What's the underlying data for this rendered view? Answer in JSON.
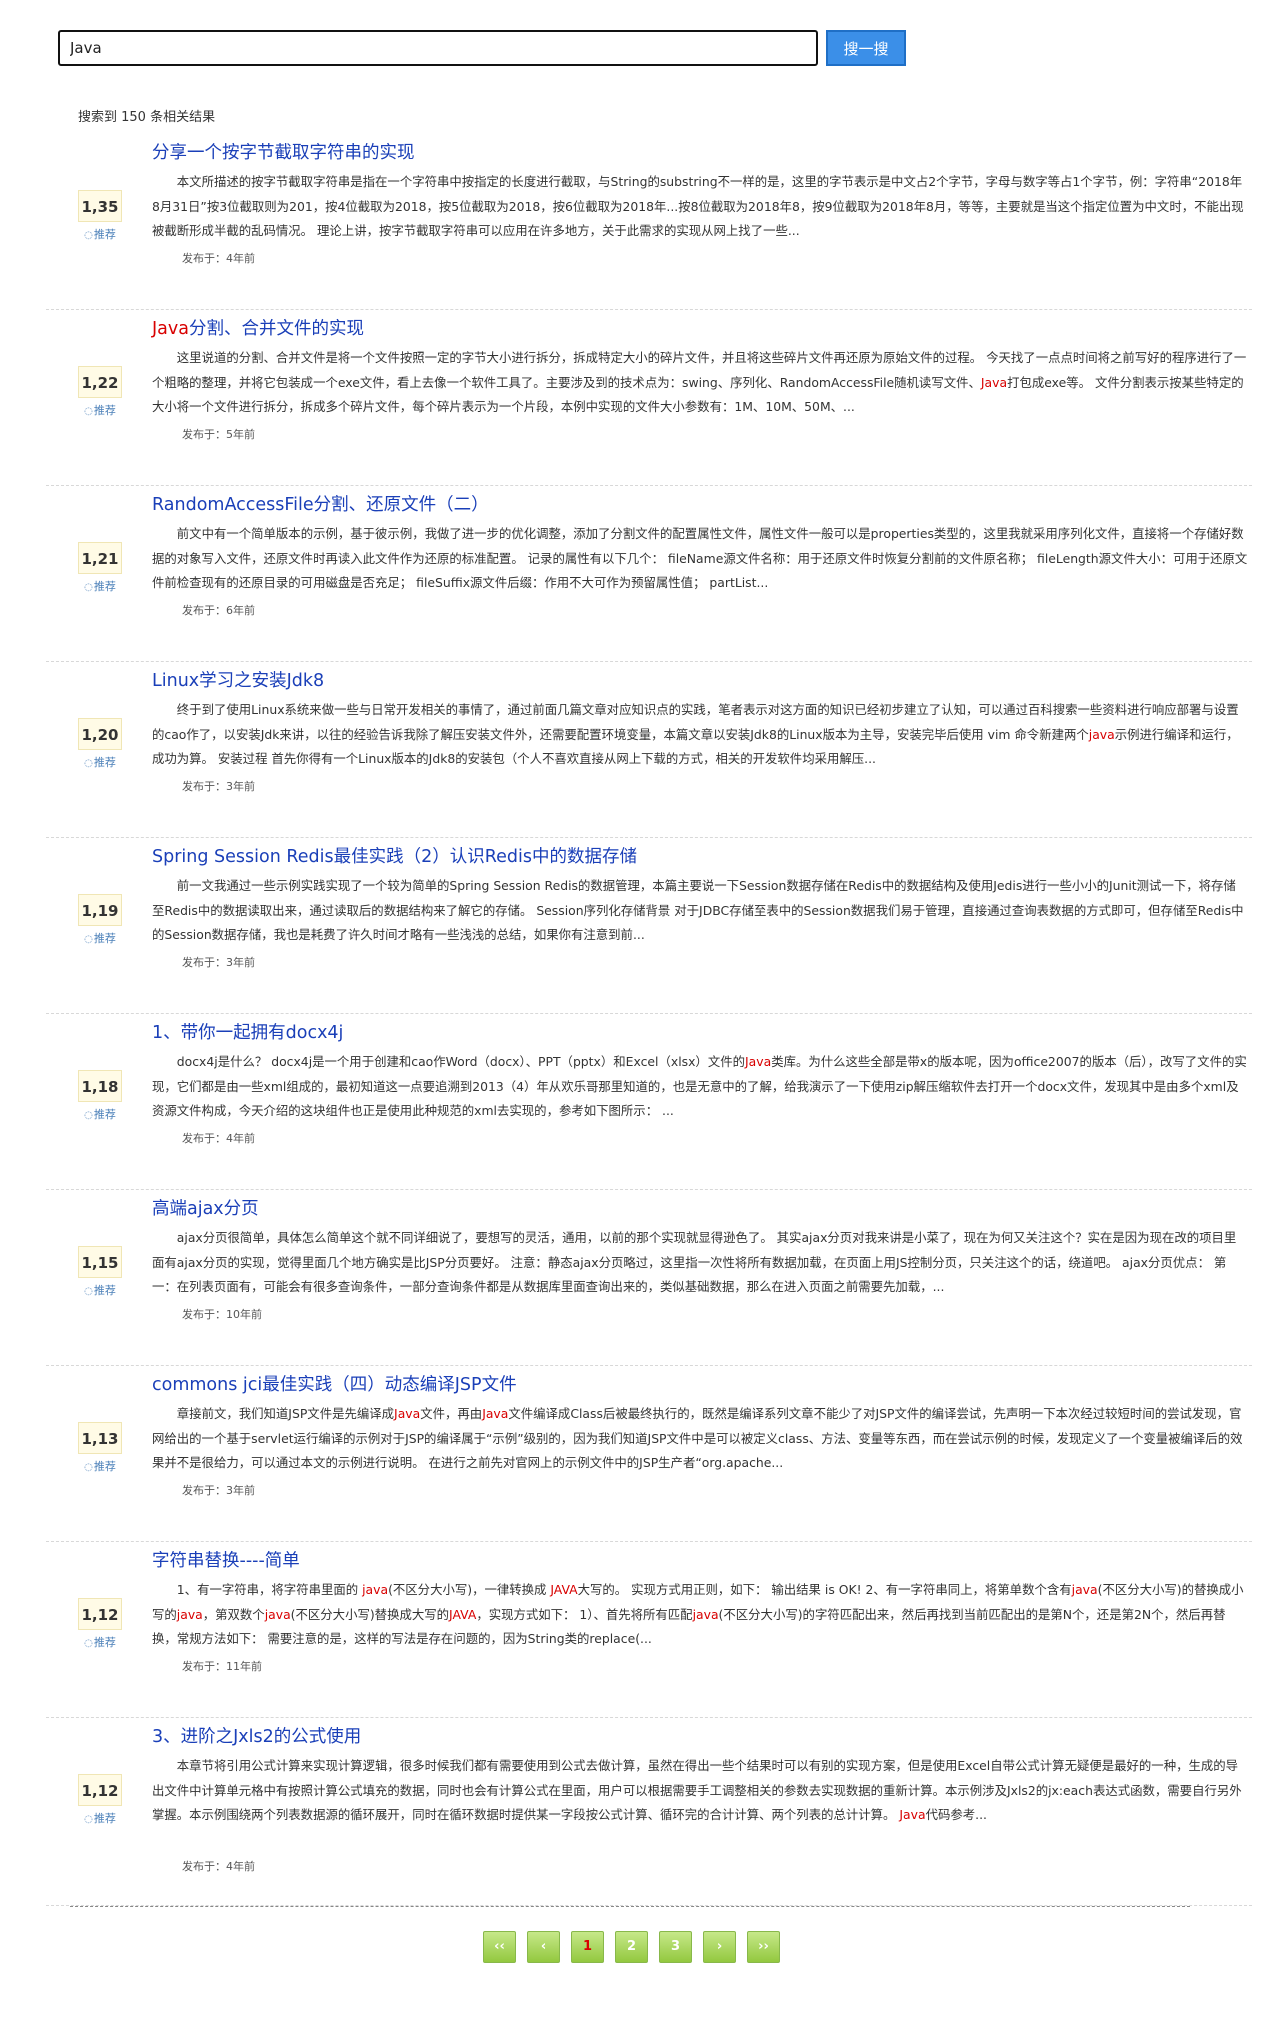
{
  "search": {
    "query": "Java",
    "button_label": "搜一搜"
  },
  "result_count_text": "搜索到 150 条相关结果",
  "recommend_label": "推荐",
  "meta_prefix": "发布于：",
  "results": [
    {
      "title": [
        {
          "t": "分享一个按字节截取字符串的实现"
        }
      ],
      "snippet": [
        {
          "t": "本文所描述的按字节截取字符串是指在一个字符串中按指定的长度进行截取，与String的substring不一样的是，这里的字节表示是中文占2个字节，字母与数字等占1个字节，例：字符串“2018年8月31日”按3位截取则为201，按4位截取为2018，按5位截取为2018，按6位截取为2018年...按8位截取为2018年8，按9位截取为2018年8月，等等，主要就是当这个指定位置为中文时，不能出现被截断形成半截的乱码情况。 理论上讲，按字节截取字符串可以应用在许多地方，关于此需求的实现从网上找了一些..."
        }
      ],
      "votes": "1,35",
      "time": "4年前"
    },
    {
      "title": [
        {
          "t": "Java",
          "hl": true
        },
        {
          "t": "分割、合并文件的实现"
        }
      ],
      "snippet": [
        {
          "t": "这里说道的分割、合并文件是将一个文件按照一定的字节大小进行拆分，拆成特定大小的碎片文件，并且将这些碎片文件再还原为原始文件的过程。 今天找了一点点时间将之前写好的程序进行了一个粗略的整理，并将它包装成一个exe文件，看上去像一个软件工具了。主要涉及到的技术点为：swing、序列化、RandomAccessFile随机读写文件、"
        },
        {
          "t": "Java",
          "hl": true
        },
        {
          "t": "打包成exe等。 文件分割表示按某些特定的大小将一个文件进行拆分，拆成多个碎片文件，每个碎片表示为一个片段，本例中实现的文件大小参数有：1M、10M、50M、..."
        }
      ],
      "votes": "1,22",
      "time": "5年前"
    },
    {
      "title": [
        {
          "t": "RandomAccessFile分割、还原文件（二）"
        }
      ],
      "snippet": [
        {
          "t": "前文中有一个简单版本的示例，基于彼示例，我做了进一步的优化调整，添加了分割文件的配置属性文件，属性文件一般可以是properties类型的，这里我就采用序列化文件，直接将一个存储好数据的对象写入文件，还原文件时再读入此文件作为还原的标准配置。 记录的属性有以下几个： fileName源文件名称：用于还原文件时恢复分割前的文件原名称； fileLength源文件大小：可用于还原文件前检查现有的还原目录的可用磁盘是否充足； fileSuffix源文件后缀：作用不大可作为预留属性值； partList..."
        }
      ],
      "votes": "1,21",
      "time": "6年前"
    },
    {
      "title": [
        {
          "t": "Linux学习之安装Jdk8"
        }
      ],
      "snippet": [
        {
          "t": "终于到了使用Linux系统来做一些与日常开发相关的事情了，通过前面几篇文章对应知识点的实践，笔者表示对这方面的知识已经初步建立了认知，可以通过百科搜索一些资料进行响应部署与设置的cao作了，以安装Jdk来讲，以往的经验告诉我除了解压安装文件外，还需要配置环境变量，本篇文章以安装Jdk8的Linux版本为主导，安装完毕后使用 vim 命令新建两个"
        },
        {
          "t": "java",
          "hl": true
        },
        {
          "t": "示例进行编译和运行，成功为算。 安装过程 首先你得有一个Linux版本的Jdk8的安装包（个人不喜欢直接从网上下载的方式，相关的开发软件均采用解压..."
        }
      ],
      "votes": "1,20",
      "time": "3年前"
    },
    {
      "title": [
        {
          "t": "Spring Session Redis最佳实践（2）认识Redis中的数据存储"
        }
      ],
      "snippet": [
        {
          "t": "前一文我通过一些示例实践实现了一个较为简单的Spring Session Redis的数据管理，本篇主要说一下Session数据存储在Redis中的数据结构及使用Jedis进行一些小小的Junit测试一下，将存储至Redis中的数据读取出来，通过读取后的数据结构来了解它的存储。 Session序列化存储背景 对于JDBC存储至表中的Session数据我们易于管理，直接通过查询表数据的方式即可，但存储至Redis中的Session数据存储，我也是耗费了许久时间才略有一些浅浅的总结，如果你有注意到前..."
        }
      ],
      "votes": "1,19",
      "time": "3年前"
    },
    {
      "title": [
        {
          "t": "1、带你一起拥有docx4j"
        }
      ],
      "snippet": [
        {
          "t": "docx4j是什么？ docx4j是一个用于创建和cao作Word（docx）、PPT（pptx）和Excel（xlsx）文件的"
        },
        {
          "t": "Java",
          "hl": true
        },
        {
          "t": "类库。为什么这些全部是带x的版本呢，因为office2007的版本（后），改写了文件的实现，它们都是由一些xml组成的，最初知道这一点要追溯到2013（4）年从欢乐哥那里知道的，也是无意中的了解，给我演示了一下使用zip解压缩软件去打开一个docx文件，发现其中是由多个xml及资源文件构成，今天介绍的这块组件也正是使用此种规范的xml去实现的，参考如下图所示： ..."
        }
      ],
      "votes": "1,18",
      "time": "4年前"
    },
    {
      "title": [
        {
          "t": "高端ajax分页"
        }
      ],
      "snippet": [
        {
          "t": "ajax分页很简单，具体怎么简单这个就不同详细说了，要想写的灵活，通用，以前的那个实现就显得逊色了。 其实ajax分页对我来讲是小菜了，现在为何又关注这个？实在是因为现在改的项目里面有ajax分页的实现，觉得里面几个地方确实是比JSP分页要好。 注意：静态ajax分页略过，这里指一次性将所有数据加载，在页面上用JS控制分页，只关注这个的话，绕道吧。 ajax分页优点： 第一：在列表页面有，可能会有很多查询条件，一部分查询条件都是从数据库里面查询出来的，类似基础数据，那么在进入页面之前需要先加载，..."
        }
      ],
      "votes": "1,15",
      "time": "10年前"
    },
    {
      "title": [
        {
          "t": "commons jci最佳实践（四）动态编译JSP文件"
        }
      ],
      "snippet": [
        {
          "t": "章接前文，我们知道JSP文件是先编译成"
        },
        {
          "t": "Java",
          "hl": true
        },
        {
          "t": "文件，再由"
        },
        {
          "t": "Java",
          "hl": true
        },
        {
          "t": "文件编译成Class后被最终执行的，既然是编译系列文章不能少了对JSP文件的编译尝试，先声明一下本次经过较短时间的尝试发现，官网给出的一个基于servlet运行编译的示例对于JSP的编译属于“示例”级别的，因为我们知道JSP文件中是可以被定义class、方法、变量等东西，而在尝试示例的时候，发现定义了一个变量被编译后的效果并不是很给力，可以通过本文的示例进行说明。 在进行之前先对官网上的示例文件中的JSP生产者“org.apache..."
        }
      ],
      "votes": "1,13",
      "time": "3年前"
    },
    {
      "title": [
        {
          "t": "字符串替换----简单"
        }
      ],
      "snippet": [
        {
          "t": "1、有一字符串，将字符串里面的 "
        },
        {
          "t": "java",
          "hl": true
        },
        {
          "t": "(不区分大小写)，一律转换成 "
        },
        {
          "t": "JAVA",
          "hl": true
        },
        {
          "t": "大写的。 实现方式用正则，如下： 输出结果 is OK! 2、有一字符串同上，将第单数个含有"
        },
        {
          "t": "java",
          "hl": true
        },
        {
          "t": "(不区分大小写)的替换成小写的"
        },
        {
          "t": "java",
          "hl": true
        },
        {
          "t": "，第双数个"
        },
        {
          "t": "java",
          "hl": true
        },
        {
          "t": "(不区分大小写)替换成大写的"
        },
        {
          "t": "JAVA",
          "hl": true
        },
        {
          "t": "，实现方式如下： 1）、首先将所有匹配"
        },
        {
          "t": "java",
          "hl": true
        },
        {
          "t": "(不区分大小写)的字符匹配出来，然后再找到当前匹配出的是第N个，还是第2N个，然后再替换，常规方法如下： 需要注意的是，这样的写法是存在问题的，因为String类的replace(..."
        }
      ],
      "votes": "1,12",
      "time": "11年前"
    },
    {
      "title": [
        {
          "t": "3、进阶之Jxls2的公式使用"
        }
      ],
      "snippet": [
        {
          "t": "本章节将引用公式计算来实现计算逻辑，很多时候我们都有需要使用到公式去做计算，虽然在得出一些个结果时可以有别的实现方案，但是使用Excel自带公式计算无疑便是最好的一种，生成的导出文件中计算单元格中有按照计算公式填充的数据，同时也会有计算公式在里面，用户可以根据需要手工调整相关的参数去实现数据的重新计算。本示例涉及Jxls2的jx:each表达式函数，需要自行另外掌握。本示例围绕两个列表数据源的循环展开，同时在循环数据时提供某一字段按公式计算、循环完的合计计算、两个列表的总计计算。 "
        },
        {
          "t": "Java",
          "hl": true
        },
        {
          "t": "代码参考..."
        }
      ],
      "votes": "1,12",
      "time": "4年前",
      "tall": true
    }
  ],
  "pagination": {
    "first": "‹‹",
    "prev": "‹",
    "pages": [
      "1",
      "2",
      "3"
    ],
    "current": "1",
    "next": "›",
    "last": "››"
  }
}
